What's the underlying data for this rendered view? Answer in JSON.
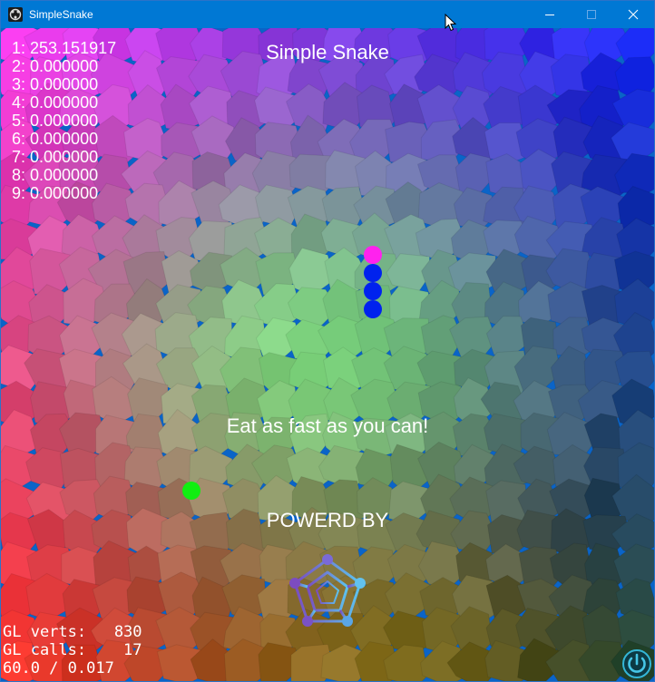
{
  "window": {
    "title": "SimpleSnake",
    "titlebar_color": "#0078d4"
  },
  "game": {
    "title": "Simple Snake",
    "message": "Eat as fast as you can!",
    "powered_by": "POWERD BY",
    "scores": [
      "1: 253.151917",
      "2: 0.000000",
      "3: 0.000000",
      "4: 0.000000",
      "5: 0.000000",
      "6: 0.000000",
      "7: 0.000000",
      "8: 0.000000",
      "9: 0.000000"
    ],
    "snake": {
      "head_color": "#ff22ee",
      "body_color": "#0022ee",
      "segments": 4
    },
    "food_color": "#11ee11",
    "stats": {
      "verts": "GL verts:   830",
      "calls": "GL calls:    17",
      "fps": "60.0 / 0.017"
    },
    "icons": {
      "engine_logo": "pentagon-logo-icon",
      "power": "power-icon"
    }
  }
}
